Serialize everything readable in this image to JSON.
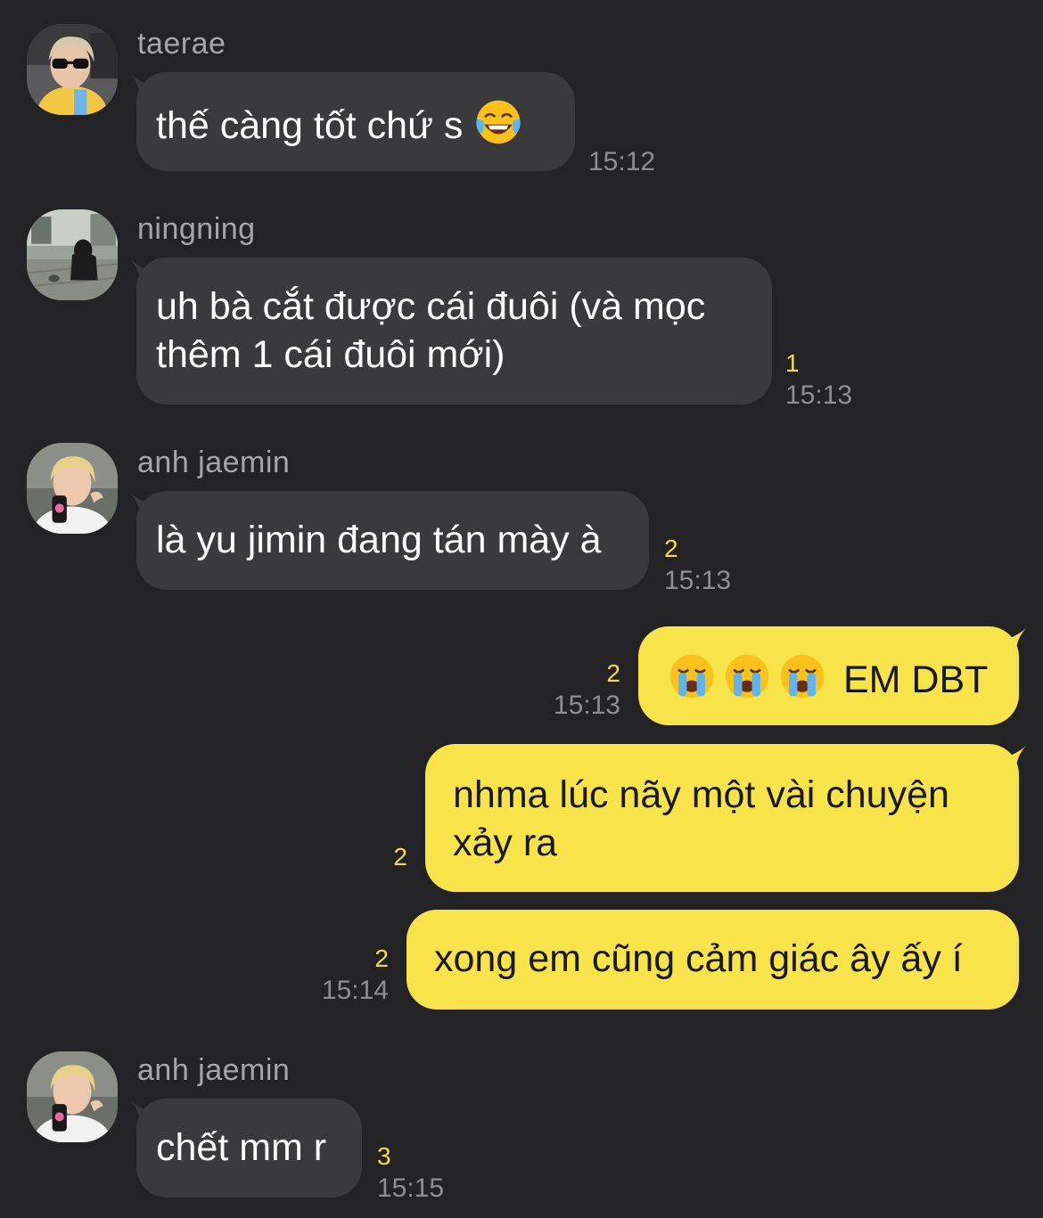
{
  "messages": [
    {
      "sender": "taerae",
      "text": "thế càng tốt chứ s",
      "emoji": "laughing-tears-emoji",
      "unread": "",
      "time": "15:12"
    },
    {
      "sender": "ningning",
      "line1": "uh bà cắt được cái đuôi (và mọc",
      "line2": "thêm 1 cái đuôi mới)",
      "unread": "1",
      "time": "15:13"
    },
    {
      "sender": "anh jaemin",
      "text": "là yu jimin đang tán mày à",
      "unread": "2",
      "time": "15:13"
    },
    {
      "sender": "me",
      "emojis": [
        "loudly-crying-emoji",
        "loudly-crying-emoji",
        "loudly-crying-emoji"
      ],
      "text": "EM DBT",
      "unread": "2",
      "time": "15:13"
    },
    {
      "sender": "me",
      "line1": "nhma lúc nãy một vài chuyện",
      "line2": "xảy ra",
      "unread": "2",
      "time": ""
    },
    {
      "sender": "me",
      "text": "xong em cũng cảm giác ây ấy í",
      "unread": "2",
      "time": "15:14"
    },
    {
      "sender": "anh jaemin",
      "text": "chết mm r",
      "unread": "3",
      "time": "15:15"
    }
  ],
  "colors": {
    "background": "#232325",
    "incoming_bubble": "#3a3a3c",
    "outgoing_bubble": "#f9e34a",
    "unread_count": "#f5dc3c",
    "timestamp": "#8f8f93",
    "sender_name": "#a6a6a8"
  }
}
